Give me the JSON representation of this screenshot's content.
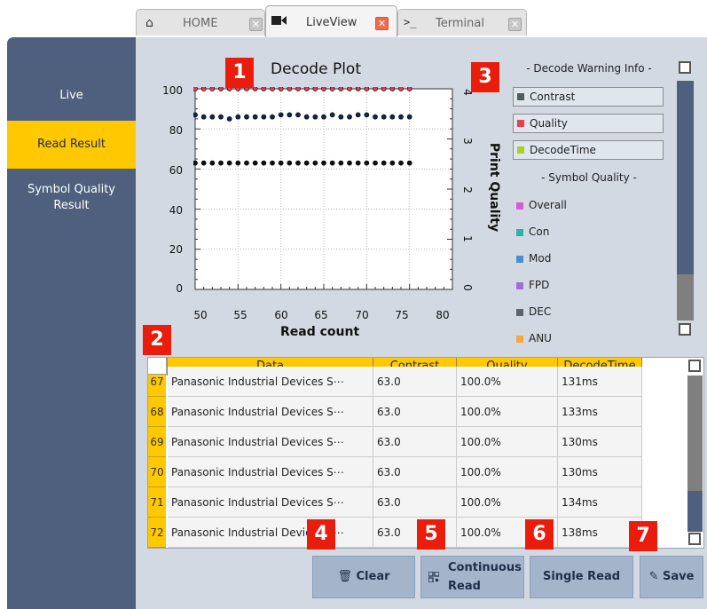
{
  "tabs": [
    {
      "label": "HOME",
      "icon": "home-icon"
    },
    {
      "label": "LiveView",
      "icon": "video-camera-icon"
    },
    {
      "label": "Terminal",
      "icon": "terminal-icon"
    }
  ],
  "sidebar": {
    "items": [
      {
        "label": "Live"
      },
      {
        "label": "Read Result"
      },
      {
        "label": "Symbol Quality Result"
      }
    ]
  },
  "plot": {
    "title": "Decode Plot",
    "xlabel": "Read count",
    "y2label": "Print Quality",
    "yticks": [
      "100",
      "80",
      "60",
      "40",
      "20",
      "0"
    ],
    "xticks": [
      "50",
      "55",
      "60",
      "65",
      "70",
      "75",
      "80"
    ],
    "y2ticks": [
      "4",
      "3",
      "2",
      "1",
      "0"
    ]
  },
  "chart_data": {
    "type": "scatter",
    "title": "Decode Plot",
    "xlabel": "Read count",
    "ylabel": "",
    "y2label": "Print Quality",
    "xlim": [
      50,
      80
    ],
    "ylim": [
      0,
      100
    ],
    "y2lim": [
      0,
      4
    ],
    "grid": true,
    "x": [
      50,
      51,
      52,
      53,
      54,
      55,
      56,
      57,
      58,
      59,
      60,
      61,
      62,
      63,
      64,
      65,
      66,
      67,
      68,
      69,
      70,
      71,
      72,
      73,
      74,
      75
    ],
    "series": [
      {
        "color": "#e83a4a",
        "values": [
          100,
          100,
          100,
          100,
          100,
          100,
          100,
          100,
          100,
          100,
          100,
          100,
          100,
          100,
          100,
          100,
          100,
          100,
          100,
          100,
          100,
          100,
          100,
          100,
          100,
          100
        ]
      },
      {
        "color": "#10265a",
        "values": [
          87,
          86,
          86,
          86,
          85,
          86,
          86,
          86,
          86,
          86,
          87,
          87,
          87,
          86,
          86,
          86,
          87,
          86,
          86,
          87,
          87,
          86,
          86,
          86,
          86,
          86
        ]
      },
      {
        "color": "#101010",
        "values": [
          63,
          63,
          63,
          63,
          63,
          63,
          63,
          63,
          63,
          63,
          63,
          63,
          63,
          63,
          63,
          63,
          63,
          63,
          63,
          63,
          63,
          63,
          63,
          63,
          63,
          63
        ]
      }
    ]
  },
  "legend": {
    "warning_header": "- Decode Warning Info -",
    "warning_items": [
      {
        "label": "Contrast",
        "color": "#4f5f5f"
      },
      {
        "label": "Quality",
        "color": "#e8404d"
      },
      {
        "label": "DecodeTime",
        "color": "#a8d027"
      }
    ],
    "symbol_header": "- Symbol Quality -",
    "symbol_items": [
      {
        "label": "Overall",
        "color": "#d65bd6"
      },
      {
        "label": "Con",
        "color": "#2eb3a2"
      },
      {
        "label": "Mod",
        "color": "#4a8ed0"
      },
      {
        "label": "FPD",
        "color": "#a26ed3"
      },
      {
        "label": "DEC",
        "color": "#5b6370"
      },
      {
        "label": "ANU",
        "color": "#f3a93c"
      }
    ]
  },
  "table": {
    "columns": [
      "Data",
      "Contrast",
      "Quality",
      "DecodeTime"
    ],
    "rows": [
      {
        "num": "67",
        "data": "Panasonic Industrial Devices S⋯",
        "contrast": "63.0",
        "quality": "100.0%",
        "time": "131ms"
      },
      {
        "num": "68",
        "data": "Panasonic Industrial Devices S⋯",
        "contrast": "63.0",
        "quality": "100.0%",
        "time": "133ms"
      },
      {
        "num": "69",
        "data": "Panasonic Industrial Devices S⋯",
        "contrast": "63.0",
        "quality": "100.0%",
        "time": "130ms"
      },
      {
        "num": "70",
        "data": "Panasonic Industrial Devices S⋯",
        "contrast": "63.0",
        "quality": "100.0%",
        "time": "130ms"
      },
      {
        "num": "71",
        "data": "Panasonic Industrial Devices S⋯",
        "contrast": "63.0",
        "quality": "100.0%",
        "time": "134ms"
      },
      {
        "num": "72",
        "data": "Panasonic Industrial Devices S⋯",
        "contrast": "63.0",
        "quality": "100.0%",
        "time": "138ms"
      }
    ]
  },
  "buttons": {
    "clear": "Clear",
    "continuous_line1": "Continuous",
    "continuous_line2": "Read",
    "single": "Single Read",
    "save": "Save"
  },
  "badges": [
    "1",
    "2",
    "3",
    "4",
    "5",
    "6",
    "7"
  ],
  "colors": {
    "accent": "#ffc800",
    "sidebar": "#4e607d",
    "badge": "#ea1c0c",
    "panel": "#d2d9e2",
    "button": "#a4b4ca"
  }
}
